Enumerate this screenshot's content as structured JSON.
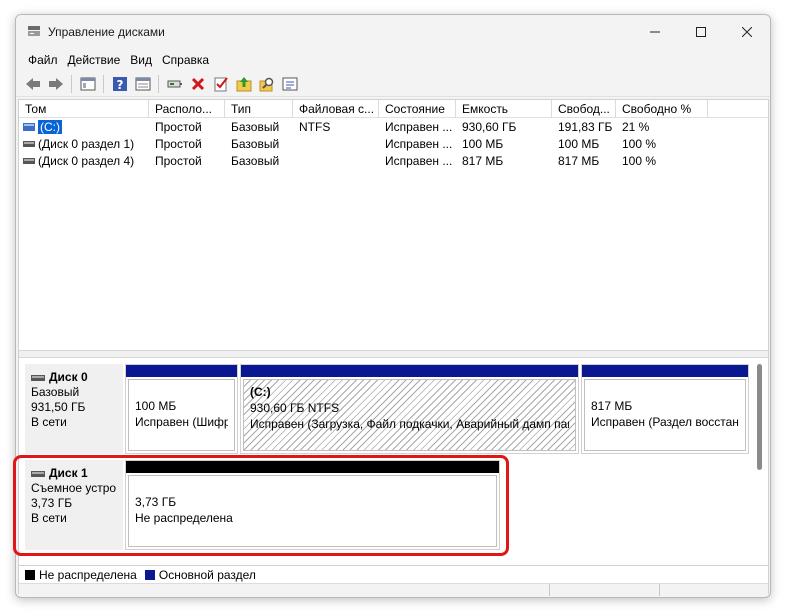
{
  "window": {
    "title": "Управление дисками",
    "minimize_icon": "minimize-icon",
    "maximize_icon": "maximize-icon",
    "close_icon": "close-icon"
  },
  "menu": [
    {
      "label": "Файл"
    },
    {
      "label": "Действие"
    },
    {
      "label": "Вид"
    },
    {
      "label": "Справка"
    }
  ],
  "toolbar": [
    "back-icon",
    "forward-icon",
    "panel-icon",
    "help-icon",
    "properties-icon",
    "connect-icon",
    "delete-icon",
    "check-icon",
    "up-folder-icon",
    "search-icon",
    "info-icon"
  ],
  "columns": [
    "Том",
    "Располо...",
    "Тип",
    "Файловая с...",
    "Состояние",
    "Емкость",
    "Свобод...",
    "Свободно %"
  ],
  "volumes": [
    {
      "name": "(C:)",
      "layout": "Простой",
      "type": "Базовый",
      "fs": "NTFS",
      "status": "Исправен ...",
      "capacity": "930,60 ГБ",
      "free": "191,83 ГБ",
      "free_pct": "21 %"
    },
    {
      "name": "(Диск 0 раздел 1)",
      "layout": "Простой",
      "type": "Базовый",
      "fs": "",
      "status": "Исправен ...",
      "capacity": "100 МБ",
      "free": "100 МБ",
      "free_pct": "100 %"
    },
    {
      "name": "(Диск 0 раздел 4)",
      "layout": "Простой",
      "type": "Базовый",
      "fs": "",
      "status": "Исправен ...",
      "capacity": "817 МБ",
      "free": "817 МБ",
      "free_pct": "100 %"
    }
  ],
  "disks": [
    {
      "name": "Диск 0",
      "kind": "Базовый",
      "size": "931,50 ГБ",
      "state": "В сети",
      "partitions": [
        {
          "title": "",
          "line1": "100 МБ",
          "line2": "Исправен (Шифров"
        },
        {
          "title": "(C:)",
          "line1": "930,60 ГБ NTFS",
          "line2": "Исправен (Загрузка, Файл подкачки, Аварийный дамп пам..."
        },
        {
          "title": "",
          "line1": "817 МБ",
          "line2": "Исправен (Раздел восстанов"
        }
      ]
    },
    {
      "name": "Диск 1",
      "kind": "Съемное устро",
      "size": "3,73 ГБ",
      "state": "В сети",
      "partitions": [
        {
          "title": "",
          "line1": "3,73 ГБ",
          "line2": "Не распределена"
        }
      ]
    }
  ],
  "legend": [
    {
      "label": "Не распределена",
      "color": "#000000"
    },
    {
      "label": "Основной раздел",
      "color": "#0a1790"
    }
  ],
  "colors": {
    "highlight": "#e01717",
    "primary_partition": "#0a1790",
    "selection": "#0a64d6"
  }
}
